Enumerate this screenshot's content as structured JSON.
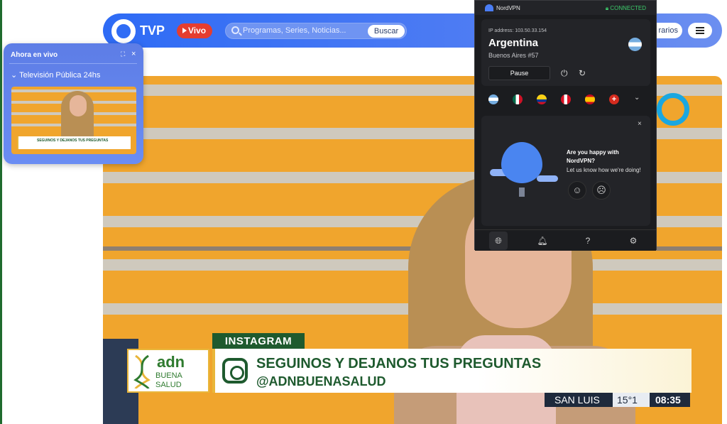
{
  "header": {
    "brand": "TVP",
    "vivo_label": "Vivo",
    "search_placeholder": "Programas, Series, Noticias...",
    "search_button": "Buscar",
    "horarios_label": "rarios"
  },
  "live_popup": {
    "title": "Ahora en vivo",
    "channel": "Televisión Pública 24hs",
    "thumb_banner": "SEGUINOS Y DEJANOS TUS PREGUNTAS"
  },
  "lower_third": {
    "tag": "INSTAGRAM",
    "adn_word": "adn",
    "adn_buena": "BUENA",
    "adn_salud": "SALUD",
    "title": "SEGUINOS Y DEJANOS TUS PREGUNTAS",
    "handle": "@ADNBUENASALUD",
    "city": "SAN LUIS",
    "temp": "15°1",
    "time": "08:35"
  },
  "vpn": {
    "app_name": "NordVPN",
    "status": "CONNECTED",
    "ip": "IP address: 103.50.33.154",
    "country": "Argentina",
    "server": "Buenos Aires #57",
    "pause": "Pause",
    "question": "Are you happy with NordVPN?",
    "subtitle": "Let us know how we're doing!",
    "flags": [
      "argentina",
      "mexico",
      "colombia",
      "peru",
      "spain",
      "switzerland"
    ],
    "colors": {
      "status": "#3ccb6a",
      "accent": "#4a7df5",
      "bg": "#1b1c1f"
    }
  },
  "colors": {
    "nav_blue": "#2e6bf5",
    "vivo_red": "#e53d2f",
    "lower_third_green": "#1e5a2e"
  }
}
